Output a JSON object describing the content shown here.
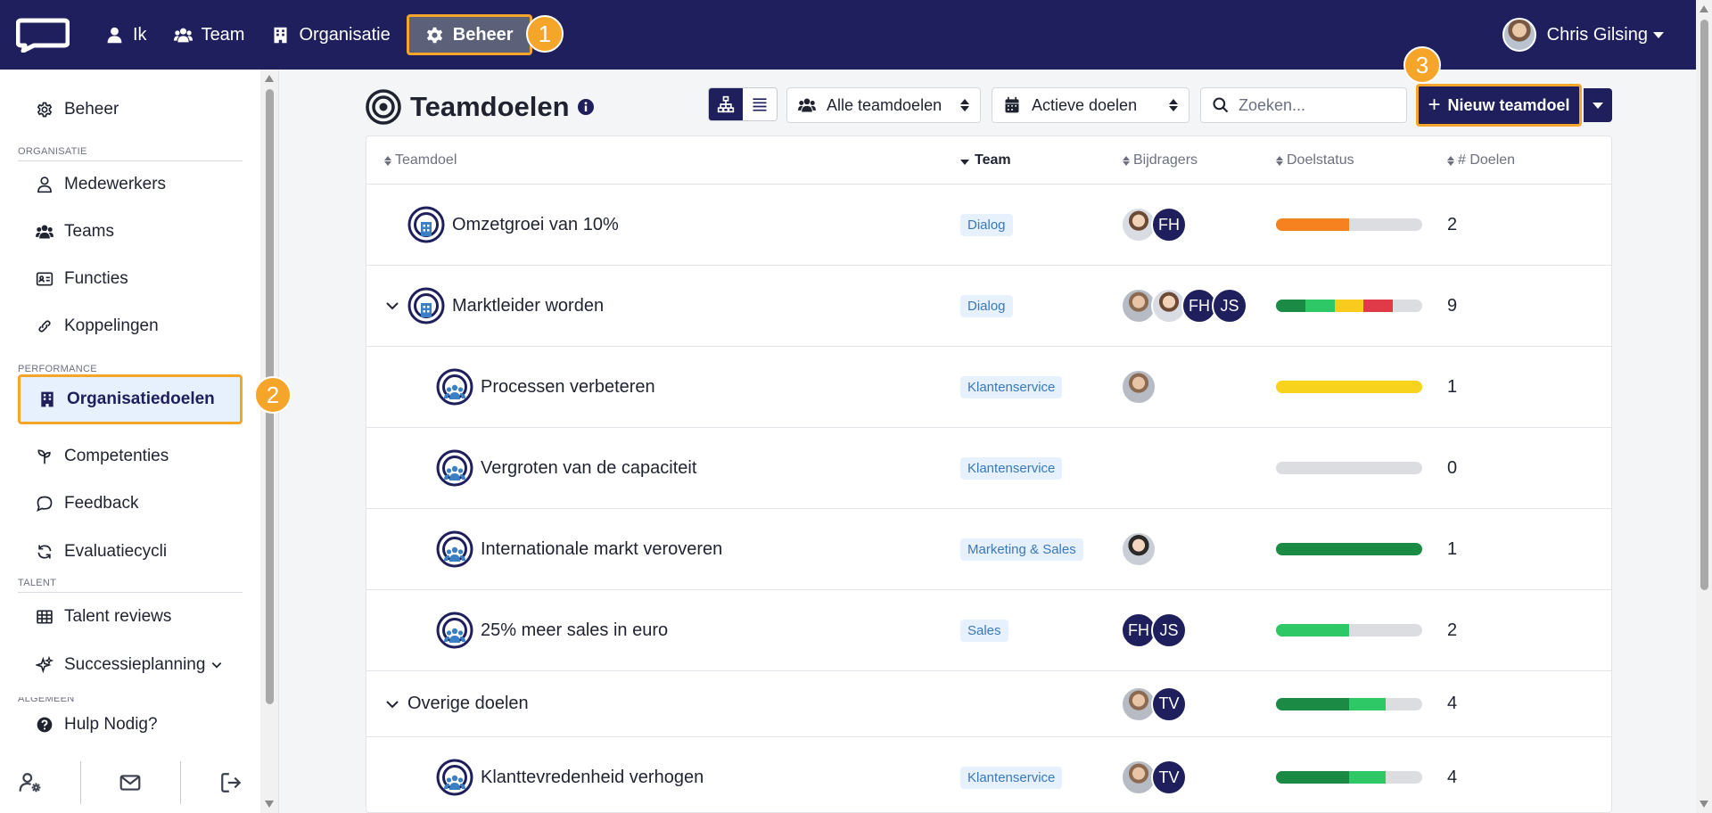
{
  "topbar": {
    "nav": [
      {
        "label": "Ik",
        "icon": "user-icon"
      },
      {
        "label": "Team",
        "icon": "users-icon"
      },
      {
        "label": "Organisatie",
        "icon": "building-icon"
      },
      {
        "label": "Beheer",
        "icon": "gear-icon",
        "active": true
      }
    ],
    "user_name": "Chris Gilsing",
    "colors": {
      "navy": "#1e1f5c",
      "highlight": "#f6a52b"
    }
  },
  "callouts": [
    "1",
    "2",
    "3"
  ],
  "sidebar": {
    "top_item": "Beheer",
    "sections": [
      "ORGANISATIE",
      "PERFORMANCE",
      "TALENT",
      "ALGEMEEN"
    ],
    "organisatie": [
      "Medewerkers",
      "Teams",
      "Functies",
      "Koppelingen"
    ],
    "performance": [
      "Organisatiedoelen",
      "Competenties",
      "Feedback",
      "Evaluatiecycli"
    ],
    "talent": [
      "Talent reviews",
      "Successieplanning"
    ],
    "help": "Hulp Nodig?"
  },
  "main": {
    "title": "Teamdoelen",
    "filter_scope": "Alle teamdoelen",
    "filter_status": "Actieve doelen",
    "search_placeholder": "Zoeken...",
    "new_button": "Nieuw teamdoel"
  },
  "table": {
    "columns": [
      "Teamdoel",
      "Team",
      "Bijdragers",
      "Doelstatus",
      "# Doelen"
    ],
    "rows": [
      {
        "name": "Omzetgroei van 10%",
        "team": "Dialog",
        "count": "2",
        "avatars": [
          "p1",
          "FH"
        ]
      },
      {
        "name": "Marktleider worden",
        "team": "Dialog",
        "count": "9",
        "avatars": [
          "p3",
          "p1",
          "FH",
          "JS"
        ]
      },
      {
        "name": "Processen verbeteren",
        "team": "Klantenservice",
        "count": "1",
        "avatars": [
          "p3"
        ]
      },
      {
        "name": "Vergroten van de capaciteit",
        "team": "Klantenservice",
        "count": "0",
        "avatars": []
      },
      {
        "name": "Internationale markt veroveren",
        "team": "Marketing & Sales",
        "count": "1",
        "avatars": [
          "p2"
        ]
      },
      {
        "name": "25% meer sales in euro",
        "team": "Sales",
        "count": "2",
        "avatars": [
          "FH",
          "JS"
        ]
      },
      {
        "name": "Overige doelen",
        "team": "",
        "count": "4",
        "avatars": [
          "p3",
          "TV"
        ]
      },
      {
        "name": "Klanttevredenheid verhogen",
        "team": "Klantenservice",
        "count": "4",
        "avatars": [
          "p3",
          "TV"
        ]
      }
    ],
    "status_bars": [
      [
        {
          "color": "#f5821f",
          "fraction": 0.5
        }
      ],
      [
        {
          "color": "#1a8a45",
          "fraction": 0.2
        },
        {
          "color": "#2ec866",
          "fraction": 0.2
        },
        {
          "color": "#f8cb1e",
          "fraction": 0.2
        },
        {
          "color": "#e03a48",
          "fraction": 0.2
        }
      ],
      [
        {
          "color": "#f8d31e",
          "fraction": 1.0
        }
      ],
      [],
      [
        {
          "color": "#1a8a45",
          "fraction": 1.0
        }
      ],
      [
        {
          "color": "#2ec866",
          "fraction": 0.5
        }
      ],
      [
        {
          "color": "#1a8a45",
          "fraction": 0.5
        },
        {
          "color": "#2ec866",
          "fraction": 0.25
        }
      ],
      [
        {
          "color": "#1a8a45",
          "fraction": 0.5
        },
        {
          "color": "#2ec866",
          "fraction": 0.25
        }
      ]
    ]
  }
}
